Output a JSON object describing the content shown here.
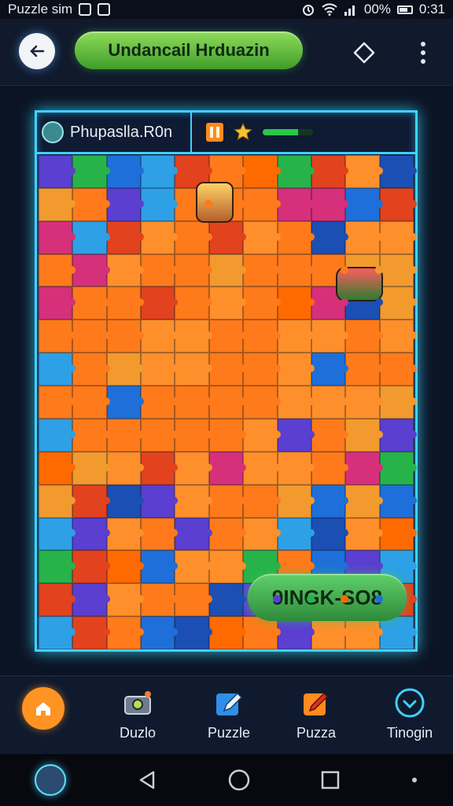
{
  "status_bar": {
    "app_name": "Puzzle sim",
    "battery": "00%",
    "time": "0:31",
    "icons": [
      "notification-icon",
      "image-icon",
      "alarm-icon",
      "wifi-icon",
      "signal-icon",
      "battery-icon"
    ]
  },
  "top_bar": {
    "title": "Undancail Hrduazin",
    "back_icon": "back-arrow-icon",
    "shape_icon": "diamond-icon",
    "more_icon": "more-vertical-icon"
  },
  "board": {
    "player_name": "Phupaslla.R0n",
    "progress_fraction": 0.7,
    "solve_button": "9INGK-SO8"
  },
  "bottom_nav": {
    "items": [
      {
        "label": "",
        "icon": "home-icon"
      },
      {
        "label": "Duzlo",
        "icon": "puzzle-box-icon"
      },
      {
        "label": "Puzzle",
        "icon": "pen-icon"
      },
      {
        "label": "Puzza",
        "icon": "pencil-icon"
      },
      {
        "label": "Tinogin",
        "icon": "download-icon"
      }
    ]
  },
  "colors": {
    "accent_cyan": "#3fd2ff",
    "accent_green": "#4fc04f",
    "accent_orange": "#ff9324",
    "bg": "#0b1424"
  }
}
